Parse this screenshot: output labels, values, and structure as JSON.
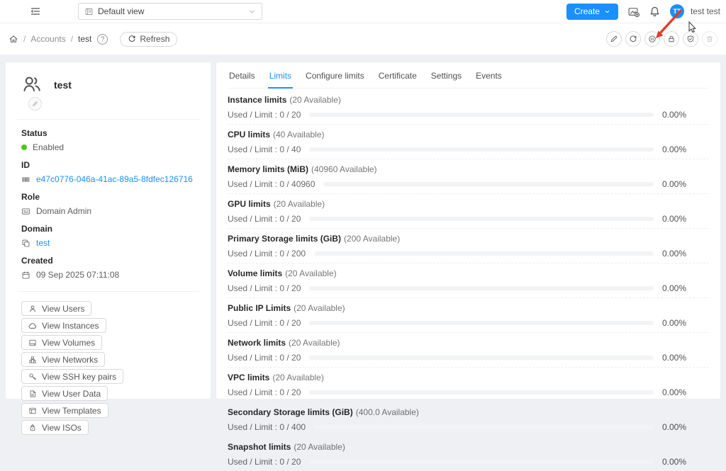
{
  "topbar": {
    "view_select_value": "Default view",
    "create_label": "Create",
    "user_initials": "TT",
    "user_name": "test test"
  },
  "subheader": {
    "breadcrumb_parent": "Accounts",
    "breadcrumb_current": "test",
    "refresh_label": "Refresh",
    "actions": [
      {
        "name": "edit-account",
        "icon": "edit",
        "disabled": false
      },
      {
        "name": "update-resource-count",
        "icon": "sync",
        "disabled": false
      },
      {
        "name": "disable-account",
        "icon": "pause-circle",
        "disabled": false
      },
      {
        "name": "lock-account",
        "icon": "lock",
        "disabled": false
      },
      {
        "name": "certificate",
        "icon": "shield-check",
        "disabled": false
      },
      {
        "name": "delete-account",
        "icon": "trash",
        "disabled": true
      }
    ]
  },
  "sidebar": {
    "account_name": "test",
    "fields": [
      {
        "label": "Status",
        "value": "Enabled",
        "icon": "status-dot",
        "link": false
      },
      {
        "label": "ID",
        "value": "e47c0776-046a-41ac-89a5-8fdfec126716",
        "icon": "barcode",
        "link": true
      },
      {
        "label": "Role",
        "value": "Domain Admin",
        "icon": "idcard",
        "link": false
      },
      {
        "label": "Domain",
        "value": "test",
        "icon": "block",
        "link": true
      },
      {
        "label": "Created",
        "value": "09 Sep 2025 07:11:08",
        "icon": "calendar",
        "link": false
      }
    ],
    "view_buttons": [
      {
        "label": "View Users",
        "icon": "user"
      },
      {
        "label": "View Instances",
        "icon": "cloud"
      },
      {
        "label": "View Volumes",
        "icon": "hdd"
      },
      {
        "label": "View Networks",
        "icon": "apartment"
      },
      {
        "label": "View SSH key pairs",
        "icon": "key"
      },
      {
        "label": "View User Data",
        "icon": "file-text"
      },
      {
        "label": "View Templates",
        "icon": "template"
      },
      {
        "label": "View ISOs",
        "icon": "iso"
      }
    ]
  },
  "main": {
    "tabs": [
      {
        "label": "Details",
        "active": false
      },
      {
        "label": "Limits",
        "active": true
      },
      {
        "label": "Configure limits",
        "active": false
      },
      {
        "label": "Certificate",
        "active": false
      },
      {
        "label": "Settings",
        "active": false
      },
      {
        "label": "Events",
        "active": false
      }
    ],
    "limits": [
      {
        "title": "Instance limits",
        "available": "(20 Available)",
        "used_limit": "Used / Limit : 0 / 20",
        "percent": "0.00%",
        "fill_pct": 0
      },
      {
        "title": "CPU limits",
        "available": "(40 Available)",
        "used_limit": "Used / Limit : 0 / 40",
        "percent": "0.00%",
        "fill_pct": 0
      },
      {
        "title": "Memory limits (MiB)",
        "available": "(40960 Available)",
        "used_limit": "Used / Limit : 0 / 40960",
        "percent": "0.00%",
        "fill_pct": 0
      },
      {
        "title": "GPU limits",
        "available": "(20 Available)",
        "used_limit": "Used / Limit : 0 / 20",
        "percent": "0.00%",
        "fill_pct": 0
      },
      {
        "title": "Primary Storage limits (GiB)",
        "available": "(200 Available)",
        "used_limit": "Used / Limit : 0 / 200",
        "percent": "0.00%",
        "fill_pct": 0
      },
      {
        "title": "Volume limits",
        "available": "(20 Available)",
        "used_limit": "Used / Limit : 0 / 20",
        "percent": "0.00%",
        "fill_pct": 0
      },
      {
        "title": "Public IP Limits",
        "available": "(20 Available)",
        "used_limit": "Used / Limit : 0 / 20",
        "percent": "0.00%",
        "fill_pct": 0
      },
      {
        "title": "Network limits",
        "available": "(20 Available)",
        "used_limit": "Used / Limit : 0 / 20",
        "percent": "0.00%",
        "fill_pct": 0
      },
      {
        "title": "VPC limits",
        "available": "(20 Available)",
        "used_limit": "Used / Limit : 0 / 20",
        "percent": "0.00%",
        "fill_pct": 0
      },
      {
        "title": "Secondary Storage limits (GiB)",
        "available": "(400.0 Available)",
        "used_limit": "Used / Limit : 0 / 400",
        "percent": "0.00%",
        "fill_pct": 0
      },
      {
        "title": "Snapshot limits",
        "available": "(20 Available)",
        "used_limit": "Used / Limit : 0 / 20",
        "percent": "0.00%",
        "fill_pct": 0
      }
    ]
  },
  "colors": {
    "primary": "#1890ff",
    "status_enabled": "#52c41a",
    "annotation_arrow": "#e23b2a"
  }
}
